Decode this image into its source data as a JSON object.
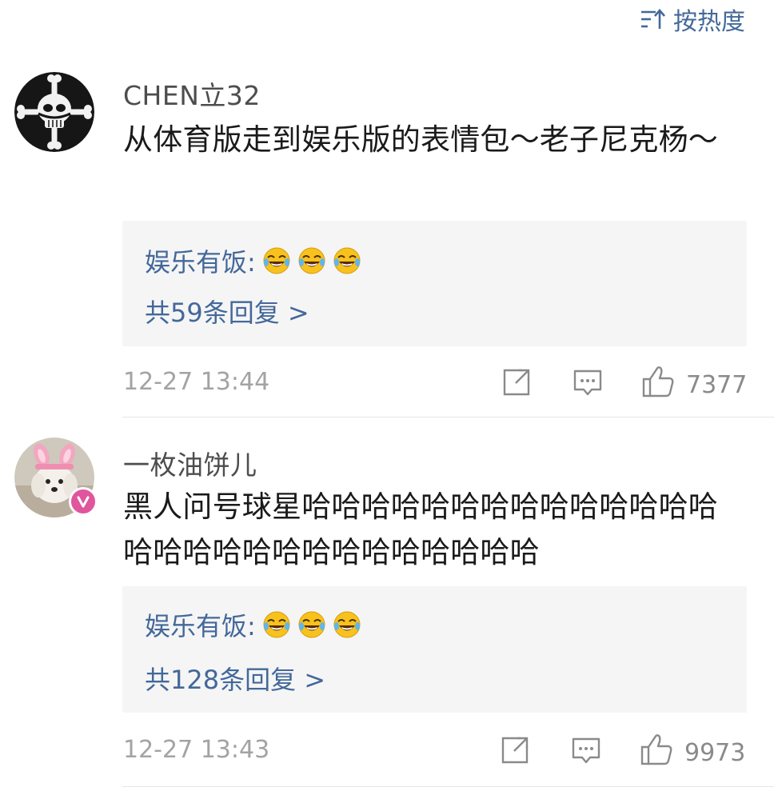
{
  "sort": {
    "label": "按热度",
    "icon": "sort-icon"
  },
  "comments": [
    {
      "username": "CHEN立32",
      "content": "从体育版走到娱乐版的表情包～老子尼克杨～",
      "reply": {
        "author": "娱乐有饭:",
        "emojis": [
          "laughing-tears-emoji",
          "laughing-tears-emoji",
          "laughing-tears-emoji"
        ],
        "count_text": "共59条回复 >"
      },
      "time": "12-27 13:44",
      "likes": "7377"
    },
    {
      "username": "一枚油饼儿",
      "content": "黑人问号球星哈哈哈哈哈哈哈哈哈哈哈哈哈哈哈哈哈哈哈哈哈哈哈哈哈哈哈哈",
      "reply": {
        "author": "娱乐有饭:",
        "emojis": [
          "laughing-tears-emoji",
          "laughing-tears-emoji",
          "laughing-tears-emoji"
        ],
        "count_text": "共128条回复 >"
      },
      "time": "12-27 13:43",
      "likes": "9973"
    }
  ],
  "colors": {
    "link": "#43689a",
    "meta": "#a3a3a3",
    "reply_bg": "#f5f5f5",
    "vip": "#e0569d"
  }
}
